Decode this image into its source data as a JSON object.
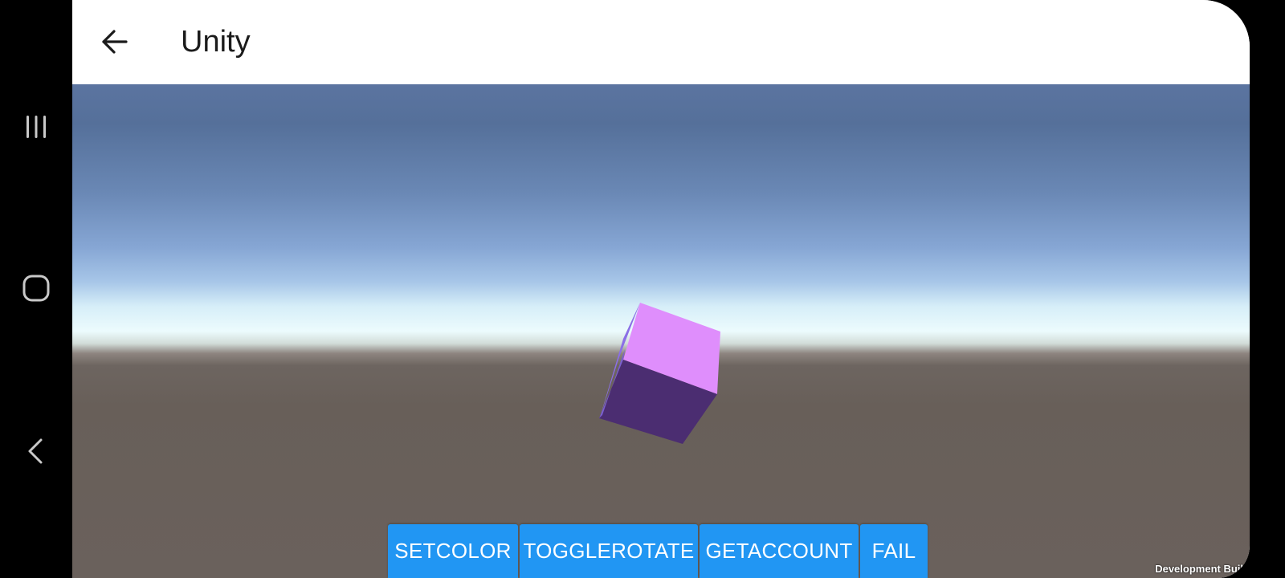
{
  "system_nav": {
    "recents_icon": "recents-icon",
    "home_icon": "home-icon",
    "back_icon": "back-chevron-icon"
  },
  "app_bar": {
    "back_icon": "arrow-back-icon",
    "title": "Unity"
  },
  "unity": {
    "cube_colors": {
      "top": "#df8efc",
      "front": "#4b2d71",
      "left": "#8b6fe6"
    },
    "buttons": [
      {
        "label": "SETCOLOR"
      },
      {
        "label": "TOGGLEROTATE"
      },
      {
        "label": "GETACCOUNT"
      },
      {
        "label": "FAIL"
      }
    ],
    "watermark": "Development Buil"
  },
  "colors": {
    "button_bg": "#2196f3",
    "app_bar_bg": "#ffffff",
    "ground": "#6a615c",
    "sky_top": "#55709a"
  }
}
